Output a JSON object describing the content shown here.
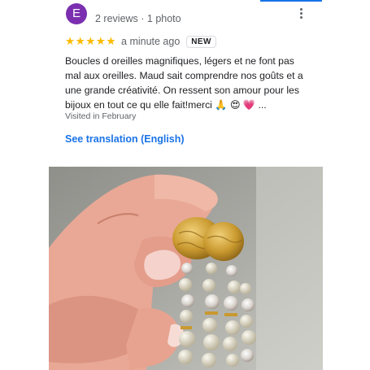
{
  "review": {
    "avatar_initial": "E",
    "meta": "2 reviews · 1 photo",
    "stars": "★★★★★",
    "rating": 5,
    "time_ago": "a minute ago",
    "badge": "NEW",
    "text": "Boucles d oreilles magnifiques, légers et ne font pas mal aux oreilles. Maud sait comprendre nos goûts et a une grande créativité. On ressent son amour pour les bijoux en tout ce qu elle fait!merci 🙏 😍 💗 ...",
    "visited": "Visited in February",
    "translation_link": "See translation (English)"
  },
  "icons": {
    "more": "more-vert-icon"
  },
  "colors": {
    "avatar": "#7b2fb0",
    "star": "#fbbc04",
    "link": "#1a73e8",
    "muted": "#5f6368"
  }
}
